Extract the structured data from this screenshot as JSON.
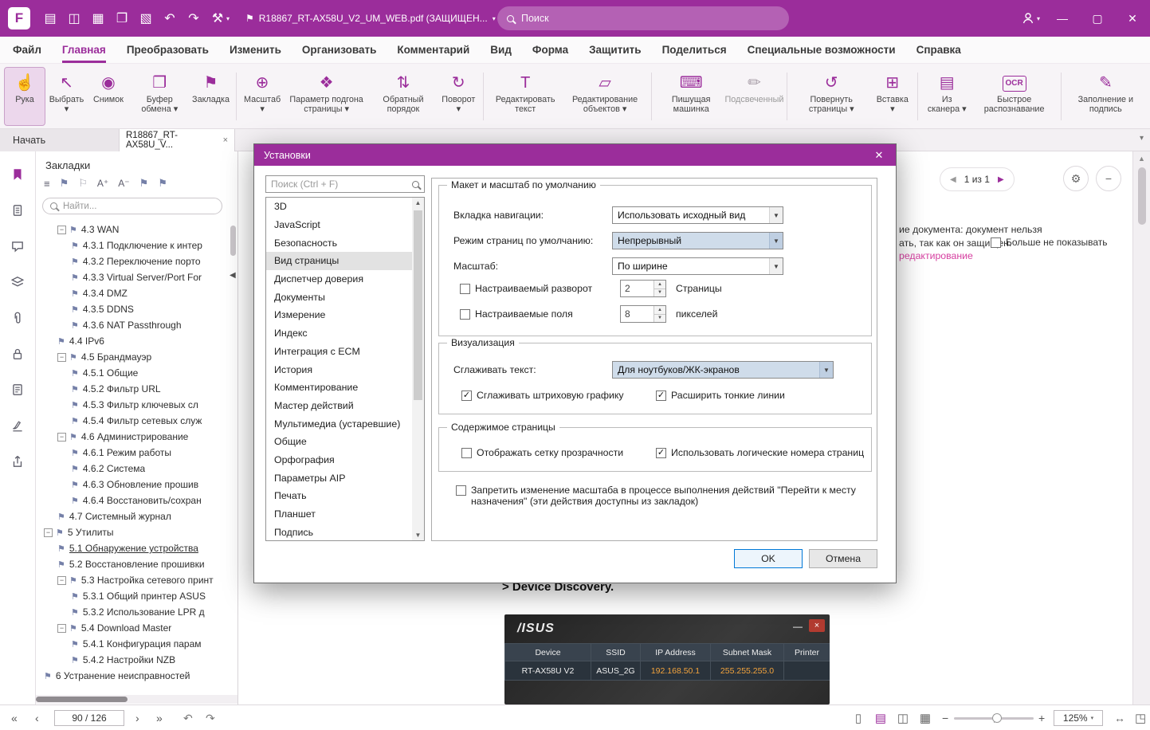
{
  "colors": {
    "brand": "#9B2D9B",
    "focus_blue": "#0078D7",
    "link_pink": "#D63FA0",
    "asus_orange": "#F2A33C"
  },
  "titlebar": {
    "document_title": "R18867_RT-AX58U_V2_UM_WEB.pdf (ЗАЩИЩЕН...",
    "search_placeholder": "Поиск"
  },
  "menubar": {
    "items": [
      "Файл",
      "Главная",
      "Преобразовать",
      "Изменить",
      "Организовать",
      "Комментарий",
      "Вид",
      "Форма",
      "Защитить",
      "Поделиться",
      "Специальные возможности",
      "Справка"
    ],
    "active_index": 1
  },
  "ribbon": {
    "buttons": [
      {
        "label": "Рука",
        "icon": "hand-icon",
        "selected": true
      },
      {
        "label": "Выбрать",
        "icon": "select-icon",
        "dropdown": true
      },
      {
        "label": "Снимок",
        "icon": "snapshot-icon"
      },
      {
        "label": "Буфер обмена",
        "icon": "clipboard-icon",
        "dropdown": true
      },
      {
        "label": "Закладка",
        "icon": "bookmark-add-icon",
        "sep": true
      },
      {
        "label": "Масштаб",
        "icon": "zoom-icon",
        "dropdown": true
      },
      {
        "label": "Параметр подгона страницы",
        "icon": "fit-page-icon",
        "dropdown": true
      },
      {
        "label": "Обратный порядок",
        "icon": "reverse-order-icon"
      },
      {
        "label": "Поворот",
        "icon": "rotate-view-icon",
        "dropdown": true,
        "sep": true
      },
      {
        "label": "Редактировать текст",
        "icon": "edit-text-icon"
      },
      {
        "label": "Редактирование объектов",
        "icon": "edit-object-icon",
        "dropdown": true,
        "sep": true
      },
      {
        "label": "Пишущая машинка",
        "icon": "typewriter-icon"
      },
      {
        "label": "Подсвеченный",
        "icon": "highlight-icon",
        "disabled": true,
        "sep": true
      },
      {
        "label": "Повернуть страницы",
        "icon": "rotate-pages-icon",
        "dropdown": true
      },
      {
        "label": "Вставка",
        "icon": "insert-icon",
        "dropdown": true,
        "sep": true
      },
      {
        "label": "Из сканера",
        "icon": "scanner-icon",
        "dropdown": true
      },
      {
        "label": "Быстрое распознавание",
        "icon": "ocr-icon",
        "sep": true
      },
      {
        "label": "Заполнение и подпись",
        "icon": "fill-sign-icon"
      }
    ]
  },
  "tabs": {
    "start": "Начать",
    "document": "R18867_RT-AX58U_V...",
    "close": "×"
  },
  "bookmarks": {
    "title": "Закладки",
    "search_placeholder": "Найти...",
    "items": [
      {
        "label": "4.3 WAN",
        "indent": 1,
        "expander": true
      },
      {
        "label": "4.3.1 Подключение к интер",
        "indent": 2
      },
      {
        "label": "4.3.2 Переключение порто",
        "indent": 2
      },
      {
        "label": "4.3.3 Virtual Server/Port For",
        "indent": 2
      },
      {
        "label": "4.3.4 DMZ",
        "indent": 2
      },
      {
        "label": "4.3.5 DDNS",
        "indent": 2
      },
      {
        "label": "4.3.6 NAT Passthrough",
        "indent": 2
      },
      {
        "label": "4.4 IPv6",
        "indent": 1
      },
      {
        "label": "4.5 Брандмауэр",
        "indent": 1,
        "expander": true
      },
      {
        "label": "4.5.1 Общие",
        "indent": 2
      },
      {
        "label": "4.5.2 Фильтр URL",
        "indent": 2
      },
      {
        "label": "4.5.3 Фильтр ключевых сл",
        "indent": 2
      },
      {
        "label": "4.5.4 Фильтр сетевых служ",
        "indent": 2
      },
      {
        "label": "4.6 Администрирование",
        "indent": 1,
        "expander": true
      },
      {
        "label": "4.6.1 Режим работы",
        "indent": 2
      },
      {
        "label": "4.6.2 Система",
        "indent": 2
      },
      {
        "label": "4.6.3 Обновление прошив",
        "indent": 2
      },
      {
        "label": "4.6.4 Восстановить/сохран",
        "indent": 2
      },
      {
        "label": "4.7 Системный журнал",
        "indent": 1
      },
      {
        "label": "5 Утилиты",
        "indent": 0,
        "expander": true
      },
      {
        "label": "5.1 Обнаружение устройства",
        "indent": 1,
        "selected": true
      },
      {
        "label": "5.2 Восстановление прошивки",
        "indent": 1
      },
      {
        "label": "5.3 Настройка сетевого принт",
        "indent": 1,
        "expander": true
      },
      {
        "label": "5.3.1 Общий принтер ASUS",
        "indent": 2
      },
      {
        "label": "5.3.2 Использование LPR д",
        "indent": 2
      },
      {
        "label": "5.4 Download Master",
        "indent": 1,
        "expander": true
      },
      {
        "label": "5.4.1 Конфигурация парам",
        "indent": 2
      },
      {
        "label": "5.4.2 Настройки NZB",
        "indent": 2
      },
      {
        "label": "6 Устранение неисправностей",
        "indent": 0
      }
    ]
  },
  "document": {
    "pager_label": "1 из 1",
    "notice_line1": "ие документа: документ нельзя",
    "notice_line2": "ать, так как он защищен.",
    "notice_link": "редактирование",
    "notice_dismiss": "Больше не показывать",
    "heading": "> Device Discovery.",
    "asus_window": {
      "logo": "/ISUS",
      "columns": [
        "Device",
        "SSID",
        "IP Address",
        "Subnet Mask",
        "Printer"
      ],
      "row": [
        "RT-AX58U V2",
        "ASUS_2G",
        "192.168.50.1",
        "255.255.255.0",
        ""
      ]
    }
  },
  "dialog": {
    "title": "Установки",
    "search_placeholder": "Поиск (Ctrl + F)",
    "list": [
      "3D",
      "JavaScript",
      "Безопасность",
      "Вид страницы",
      "Диспетчер доверия",
      "Документы",
      "Измерение",
      "Индекс",
      "Интеграция с ECM",
      "История",
      "Комментирование",
      "Мастер действий",
      "Мультимедиа (устаревшие)",
      "Общие",
      "Орфография",
      "Параметры AIP",
      "Печать",
      "Планшет",
      "Подпись"
    ],
    "selected_item": "Вид страницы",
    "layout": {
      "legend": "Макет и масштаб по умолчанию",
      "nav_tab_label": "Вкладка навигации:",
      "nav_tab_value": "Использовать исходный вид",
      "page_mode_label": "Режим страниц по умолчанию:",
      "page_mode_value": "Непрерывный",
      "zoom_label": "Масштаб:",
      "zoom_value": "По ширине",
      "custom_spread_label": "Настраиваемый разворот",
      "custom_spread_value": "2",
      "custom_spread_suffix": "Страницы",
      "custom_margin_label": "Настраиваемые поля",
      "custom_margin_value": "8",
      "custom_margin_suffix": "пикселей"
    },
    "render": {
      "legend": "Визуализация",
      "smooth_text_label": "Сглаживать текст:",
      "smooth_text_value": "Для ноутбуков/ЖК-экранов",
      "smooth_art_label": "Сглаживать штриховую графику",
      "thin_lines_label": "Расширить тонкие линии"
    },
    "content": {
      "legend": "Содержимое страницы",
      "transparency_label": "Отображать сетку прозрачности",
      "logical_pages_label": "Использовать логические номера страниц"
    },
    "forbid_zoom_label": "Запретить изменение масштаба в процессе выполнения действий \"Перейти к месту назначения\" (эти действия доступны из закладок)",
    "checks": {
      "custom_spread": false,
      "custom_margins": false,
      "smooth_art": true,
      "thin_lines": true,
      "transparency_grid": false,
      "logical_numbers": true,
      "forbid_zoom": false,
      "dont_show_again": false
    },
    "ok": "OK",
    "cancel": "Отмена"
  },
  "statusbar": {
    "page_input": "90 / 126",
    "zoom": "125%"
  }
}
